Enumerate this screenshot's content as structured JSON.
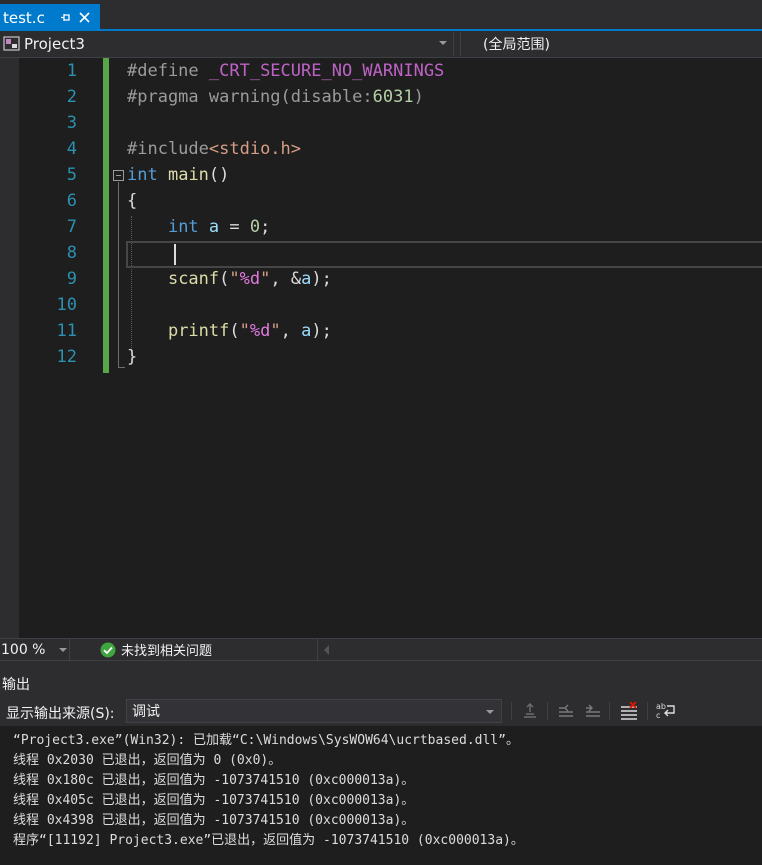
{
  "tab": {
    "filename": "test.c"
  },
  "nav": {
    "project": "Project3",
    "scope": "(全局范围)"
  },
  "code": {
    "line_numbers": [
      "1",
      "2",
      "3",
      "4",
      "5",
      "6",
      "7",
      "8",
      "9",
      "10",
      "11",
      "12"
    ],
    "lines": [
      [
        {
          "t": "#define ",
          "c": "macro"
        },
        {
          "t": "_CRT_SECURE_NO_WARNINGS",
          "c": "mname"
        }
      ],
      [
        {
          "t": "#pragma warning(disable:",
          "c": "macro"
        },
        {
          "t": "6031",
          "c": "num"
        },
        {
          "t": ")",
          "c": "macro"
        }
      ],
      [],
      [
        {
          "t": "#include",
          "c": "macro"
        },
        {
          "t": "<stdio.h>",
          "c": "inc"
        }
      ],
      [
        {
          "t": "int",
          "c": "kw"
        },
        {
          "t": " ",
          "c": "plain"
        },
        {
          "t": "main",
          "c": "func"
        },
        {
          "t": "()",
          "c": "plain"
        }
      ],
      [
        {
          "t": "{",
          "c": "plain"
        }
      ],
      [
        {
          "t": "    ",
          "c": "plain"
        },
        {
          "t": "int",
          "c": "kw"
        },
        {
          "t": " ",
          "c": "plain"
        },
        {
          "t": "a",
          "c": "var"
        },
        {
          "t": " = ",
          "c": "plain"
        },
        {
          "t": "0",
          "c": "num"
        },
        {
          "t": ";",
          "c": "plain"
        }
      ],
      [],
      [
        {
          "t": "    ",
          "c": "plain"
        },
        {
          "t": "scanf",
          "c": "func"
        },
        {
          "t": "(",
          "c": "plain"
        },
        {
          "t": "\"",
          "c": "str"
        },
        {
          "t": "%d",
          "c": "fmt"
        },
        {
          "t": "\"",
          "c": "str"
        },
        {
          "t": ", &",
          "c": "plain"
        },
        {
          "t": "a",
          "c": "var"
        },
        {
          "t": ");",
          "c": "plain"
        }
      ],
      [],
      [
        {
          "t": "    ",
          "c": "plain"
        },
        {
          "t": "printf",
          "c": "func"
        },
        {
          "t": "(",
          "c": "plain"
        },
        {
          "t": "\"",
          "c": "str"
        },
        {
          "t": "%d",
          "c": "fmt"
        },
        {
          "t": "\"",
          "c": "str"
        },
        {
          "t": ", ",
          "c": "plain"
        },
        {
          "t": "a",
          "c": "var"
        },
        {
          "t": ");",
          "c": "plain"
        }
      ],
      [
        {
          "t": "}",
          "c": "plain"
        }
      ]
    ]
  },
  "status": {
    "zoom": "100 %",
    "issues": "未找到相关问题"
  },
  "output": {
    "title": "输出",
    "source_label": "显示输出来源(S):",
    "source_value": "调试",
    "lines": [
      "“Project3.exe”(Win32): 已加载“C:\\Windows\\SysWOW64\\ucrtbased.dll”。",
      "线程 0x2030 已退出，返回值为 0 (0x0)。",
      "线程 0x180c 已退出，返回值为 -1073741510 (0xc000013a)。",
      "线程 0x405c 已退出，返回值为 -1073741510 (0xc000013a)。",
      "线程 0x4398 已退出，返回值为 -1073741510 (0xc000013a)。",
      "程序“[11192] Project3.exe”已退出，返回值为 -1073741510 (0xc000013a)。"
    ]
  },
  "colors": {
    "accent": "#007acc",
    "gutter_change": "#57a64a",
    "line_number": "#2b91af",
    "success": "#3fa53f"
  }
}
